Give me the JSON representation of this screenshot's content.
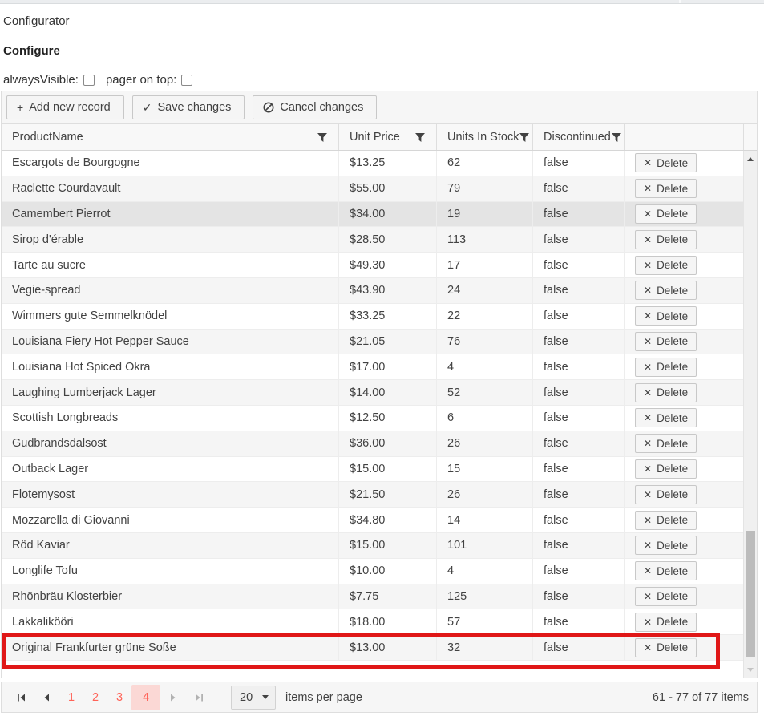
{
  "page": {
    "title": "Configurator",
    "section_heading": "Configure",
    "options": [
      {
        "label": "alwaysVisible:",
        "checked": false
      },
      {
        "label": "pager on top:",
        "checked": false
      }
    ]
  },
  "toolbar": {
    "add_label": "Add new record",
    "save_label": "Save changes",
    "cancel_label": "Cancel changes"
  },
  "icons": {
    "add_glyph": "+",
    "save_glyph": "✓",
    "delete_glyph": "✕"
  },
  "grid": {
    "columns": {
      "product": "ProductName",
      "price": "Unit Price",
      "units": "Units In Stock",
      "discontinued": "Discontinued"
    },
    "delete_label": "Delete",
    "selected_row_index": 2,
    "highlight_row_index": 19,
    "rows": [
      {
        "name": "Escargots de Bourgogne",
        "price": "$13.25",
        "units": "62",
        "discontinued": "false"
      },
      {
        "name": "Raclette Courdavault",
        "price": "$55.00",
        "units": "79",
        "discontinued": "false"
      },
      {
        "name": "Camembert Pierrot",
        "price": "$34.00",
        "units": "19",
        "discontinued": "false"
      },
      {
        "name": "Sirop d'érable",
        "price": "$28.50",
        "units": "113",
        "discontinued": "false"
      },
      {
        "name": "Tarte au sucre",
        "price": "$49.30",
        "units": "17",
        "discontinued": "false"
      },
      {
        "name": "Vegie-spread",
        "price": "$43.90",
        "units": "24",
        "discontinued": "false"
      },
      {
        "name": "Wimmers gute Semmelknödel",
        "price": "$33.25",
        "units": "22",
        "discontinued": "false"
      },
      {
        "name": "Louisiana Fiery Hot Pepper Sauce",
        "price": "$21.05",
        "units": "76",
        "discontinued": "false"
      },
      {
        "name": "Louisiana Hot Spiced Okra",
        "price": "$17.00",
        "units": "4",
        "discontinued": "false"
      },
      {
        "name": "Laughing Lumberjack Lager",
        "price": "$14.00",
        "units": "52",
        "discontinued": "false"
      },
      {
        "name": "Scottish Longbreads",
        "price": "$12.50",
        "units": "6",
        "discontinued": "false"
      },
      {
        "name": "Gudbrandsdalsost",
        "price": "$36.00",
        "units": "26",
        "discontinued": "false"
      },
      {
        "name": "Outback Lager",
        "price": "$15.00",
        "units": "15",
        "discontinued": "false"
      },
      {
        "name": "Flotemysost",
        "price": "$21.50",
        "units": "26",
        "discontinued": "false"
      },
      {
        "name": "Mozzarella di Giovanni",
        "price": "$34.80",
        "units": "14",
        "discontinued": "false"
      },
      {
        "name": "Röd Kaviar",
        "price": "$15.00",
        "units": "101",
        "discontinued": "false"
      },
      {
        "name": "Longlife Tofu",
        "price": "$10.00",
        "units": "4",
        "discontinued": "false"
      },
      {
        "name": "Rhönbräu Klosterbier",
        "price": "$7.75",
        "units": "125",
        "discontinued": "false"
      },
      {
        "name": "Lakkalikööri",
        "price": "$18.00",
        "units": "57",
        "discontinued": "false"
      },
      {
        "name": "Original Frankfurter grüne Soße",
        "price": "$13.00",
        "units": "32",
        "discontinued": "false"
      }
    ]
  },
  "pager": {
    "pages": [
      "1",
      "2",
      "3",
      "4"
    ],
    "current_page": "4",
    "page_size": "20",
    "items_per_page_label": "items per page",
    "info": "61 - 77 of 77 items"
  },
  "colors": {
    "accent_red": "#ff6358",
    "selected_page_bg": "#fbd8d5",
    "highlight_border": "#e01717"
  }
}
